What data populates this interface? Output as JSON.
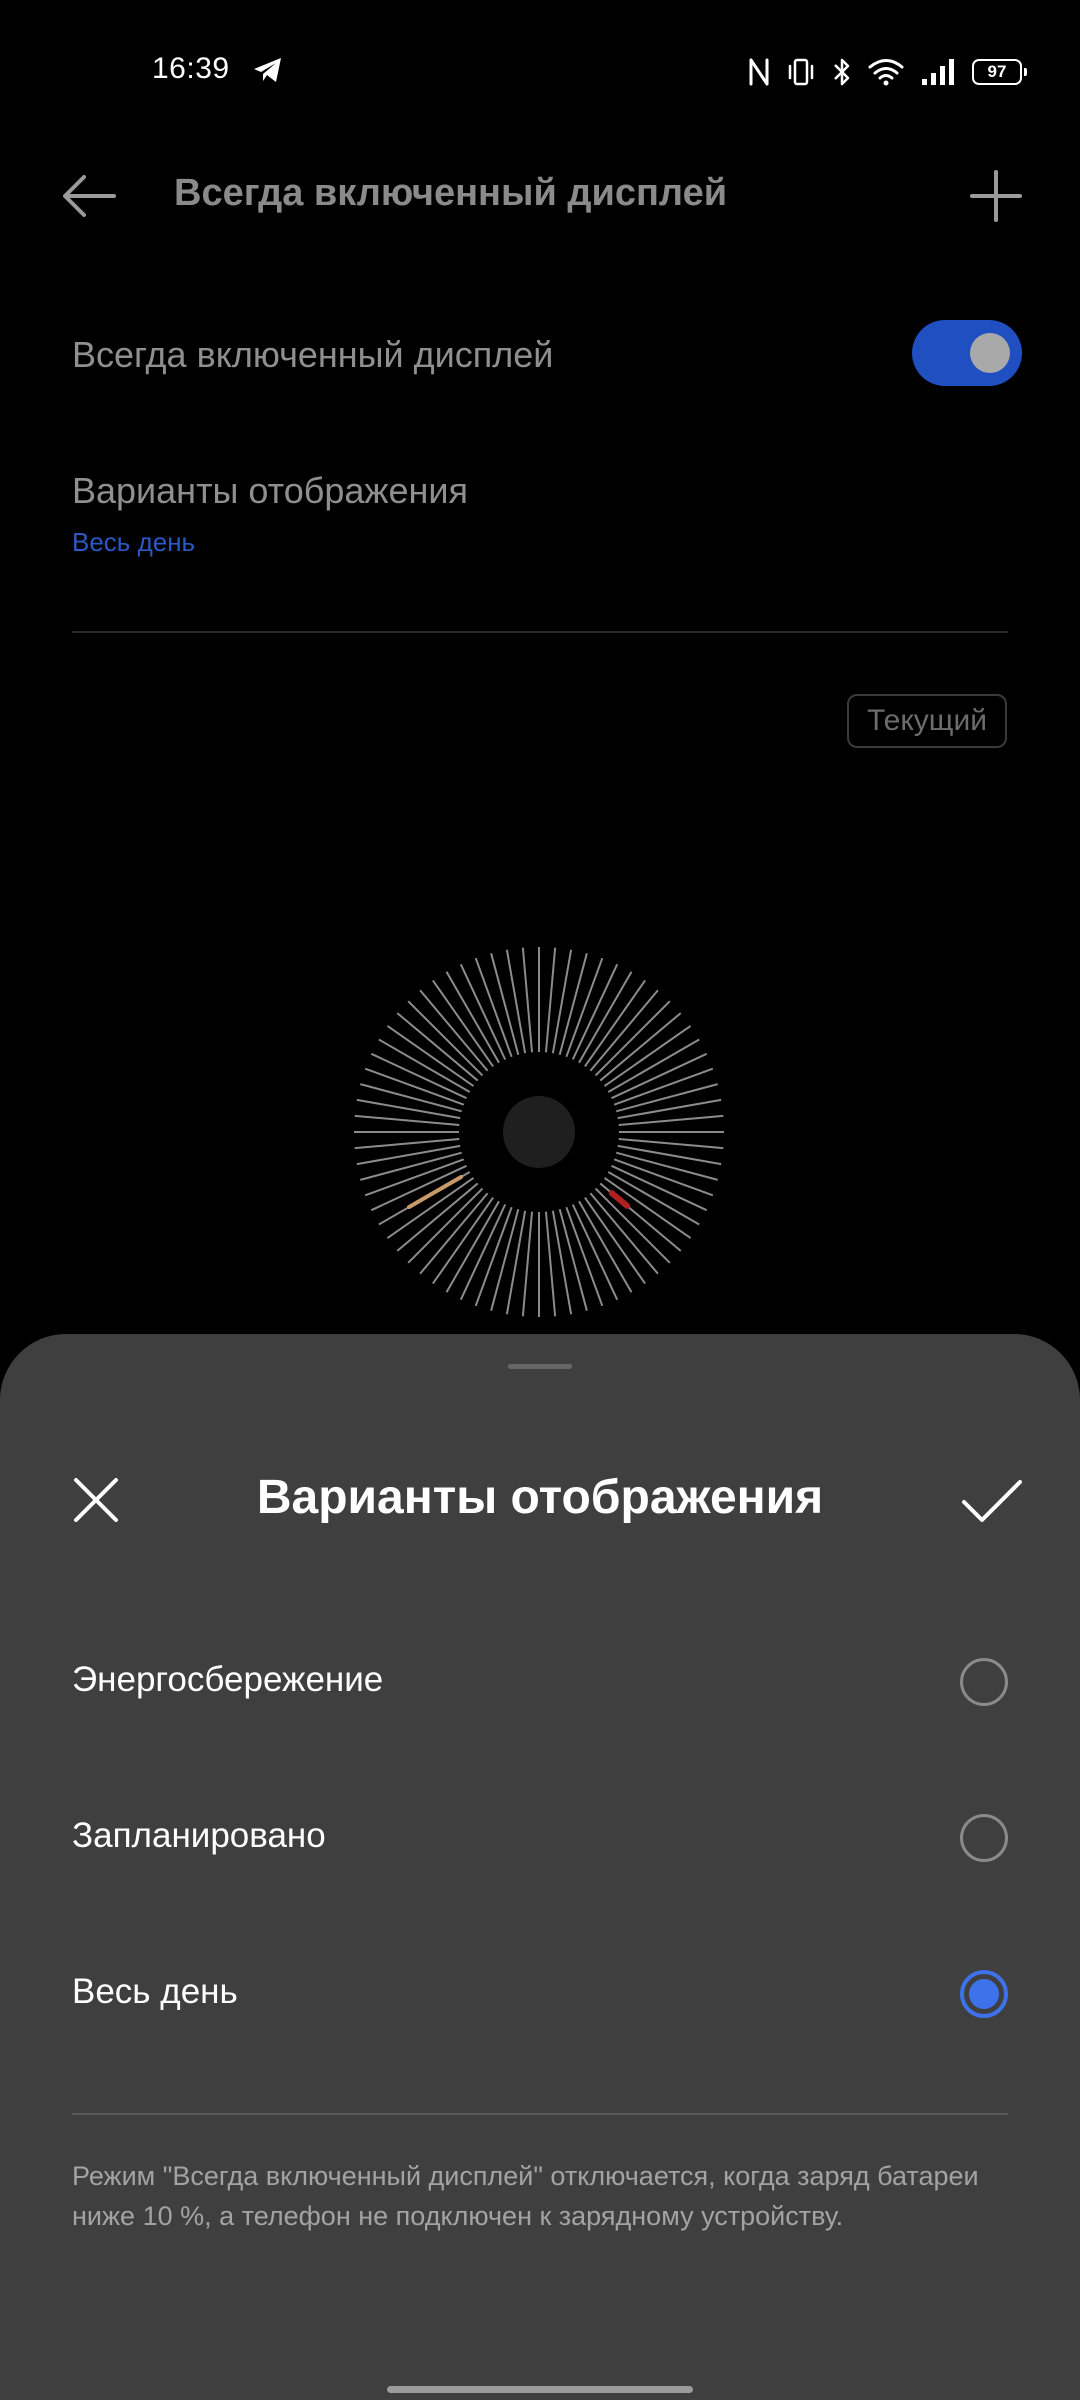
{
  "status_bar": {
    "time": "16:39",
    "battery": "97",
    "icons": [
      "telegram-icon",
      "nfc-icon",
      "vibrate-icon",
      "bluetooth-icon",
      "wifi-icon",
      "signal-icon",
      "battery-icon"
    ]
  },
  "header": {
    "title": "Всегда включенный дисплей"
  },
  "settings": {
    "aod_label": "Всегда включенный дисплей",
    "aod_enabled": true,
    "modes_label": "Варианты отображения",
    "modes_value": "Весь день",
    "current_badge": "Текущий"
  },
  "colors": {
    "accent": "#3d72ea",
    "toggle_on": "#1f4fc0",
    "link": "#2b58c2",
    "sheet_bg": "#3f3f3f"
  },
  "sheet": {
    "title": "Варианты отображения",
    "options": [
      {
        "label": "Энергосбережение",
        "selected": false
      },
      {
        "label": "Запланировано",
        "selected": false
      },
      {
        "label": "Весь день",
        "selected": true
      }
    ],
    "note": "Режим \"Всегда включенный дисплей\" отключается, когда заряд батареи ниже 10 %, а телефон не подключен к зарядному устройству."
  }
}
